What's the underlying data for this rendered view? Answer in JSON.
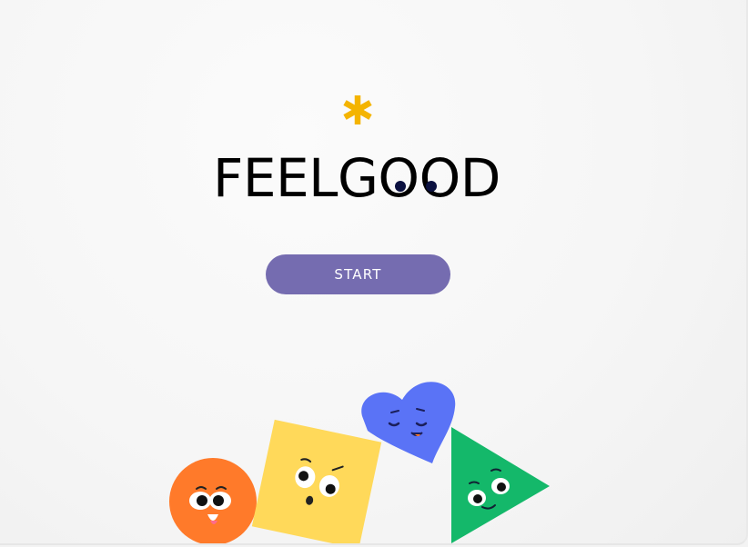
{
  "app": {
    "title": "FEELGOOD",
    "logo_icon": "asterisk-icon"
  },
  "actions": {
    "start_label": "START"
  },
  "colors": {
    "accent_yellow": "#f4b400",
    "button_purple": "#756cb0",
    "orange": "#ff7a2a",
    "yellow": "#ffd95a",
    "blue": "#5a73f6",
    "green": "#14b86a",
    "eye_navy": "#0b1140"
  },
  "mascots": [
    {
      "shape": "circle",
      "icon": "orange-circle-face-icon"
    },
    {
      "shape": "square",
      "icon": "yellow-square-face-icon"
    },
    {
      "shape": "heart",
      "icon": "blue-heart-face-icon"
    },
    {
      "shape": "triangle",
      "icon": "green-triangle-face-icon"
    }
  ]
}
